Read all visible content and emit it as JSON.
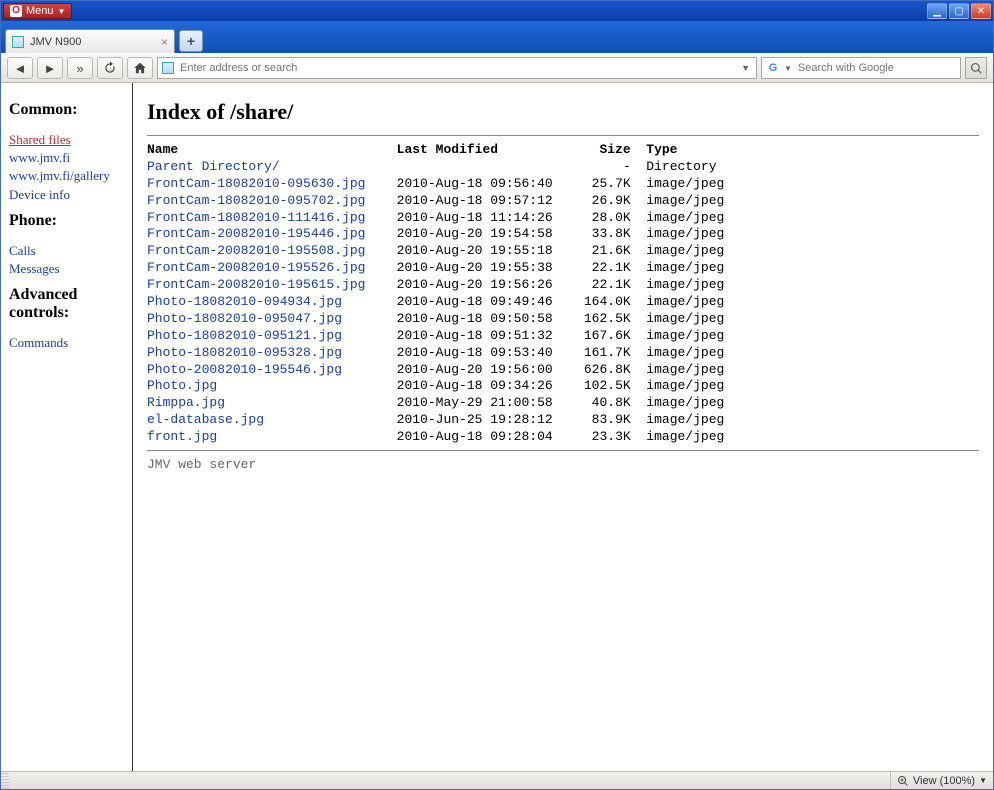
{
  "menu_label": "Menu",
  "tab": {
    "title": "JMV N900"
  },
  "address_bar": {
    "placeholder": "Enter address or search"
  },
  "search": {
    "placeholder": "Search with Google"
  },
  "sidebar": {
    "sections": [
      {
        "heading": "Common:",
        "links": [
          {
            "label": "Shared files",
            "active": true
          },
          {
            "label": "www.jmv.fi"
          },
          {
            "label": "www.jmv.fi/gallery"
          },
          {
            "label": "Device info"
          }
        ]
      },
      {
        "heading": "Phone:",
        "links": [
          {
            "label": "Calls"
          },
          {
            "label": "Messages"
          }
        ]
      },
      {
        "heading": "Advanced controls:",
        "links": [
          {
            "label": "Commands"
          }
        ]
      }
    ]
  },
  "page": {
    "title": "Index of /share/",
    "columns": {
      "name": "Name",
      "modified": "Last Modified",
      "size": "Size",
      "type": "Type"
    },
    "parent": {
      "name": "Parent Directory/",
      "modified": "",
      "size": "-",
      "type": "Directory"
    },
    "files": [
      {
        "name": "FrontCam-18082010-095630.jpg",
        "modified": "2010-Aug-18 09:56:40",
        "size": "25.7K",
        "type": "image/jpeg"
      },
      {
        "name": "FrontCam-18082010-095702.jpg",
        "modified": "2010-Aug-18 09:57:12",
        "size": "26.9K",
        "type": "image/jpeg"
      },
      {
        "name": "FrontCam-18082010-111416.jpg",
        "modified": "2010-Aug-18 11:14:26",
        "size": "28.0K",
        "type": "image/jpeg"
      },
      {
        "name": "FrontCam-20082010-195446.jpg",
        "modified": "2010-Aug-20 19:54:58",
        "size": "33.8K",
        "type": "image/jpeg"
      },
      {
        "name": "FrontCam-20082010-195508.jpg",
        "modified": "2010-Aug-20 19:55:18",
        "size": "21.6K",
        "type": "image/jpeg"
      },
      {
        "name": "FrontCam-20082010-195526.jpg",
        "modified": "2010-Aug-20 19:55:38",
        "size": "22.1K",
        "type": "image/jpeg"
      },
      {
        "name": "FrontCam-20082010-195615.jpg",
        "modified": "2010-Aug-20 19:56:26",
        "size": "22.1K",
        "type": "image/jpeg"
      },
      {
        "name": "Photo-18082010-094934.jpg",
        "modified": "2010-Aug-18 09:49:46",
        "size": "164.0K",
        "type": "image/jpeg"
      },
      {
        "name": "Photo-18082010-095047.jpg",
        "modified": "2010-Aug-18 09:50:58",
        "size": "162.5K",
        "type": "image/jpeg"
      },
      {
        "name": "Photo-18082010-095121.jpg",
        "modified": "2010-Aug-18 09:51:32",
        "size": "167.6K",
        "type": "image/jpeg"
      },
      {
        "name": "Photo-18082010-095328.jpg",
        "modified": "2010-Aug-18 09:53:40",
        "size": "161.7K",
        "type": "image/jpeg"
      },
      {
        "name": "Photo-20082010-195546.jpg",
        "modified": "2010-Aug-20 19:56:00",
        "size": "626.8K",
        "type": "image/jpeg"
      },
      {
        "name": "Photo.jpg",
        "modified": "2010-Aug-18 09:34:26",
        "size": "102.5K",
        "type": "image/jpeg"
      },
      {
        "name": "Rimppa.jpg",
        "modified": "2010-May-29 21:00:58",
        "size": "40.8K",
        "type": "image/jpeg"
      },
      {
        "name": "el-database.jpg",
        "modified": "2010-Jun-25 19:28:12",
        "size": "83.9K",
        "type": "image/jpeg"
      },
      {
        "name": "front.jpg",
        "modified": "2010-Aug-18 09:28:04",
        "size": "23.3K",
        "type": "image/jpeg"
      }
    ],
    "footer": "JMV web server"
  },
  "status": {
    "zoom_label": "View (100%)"
  }
}
